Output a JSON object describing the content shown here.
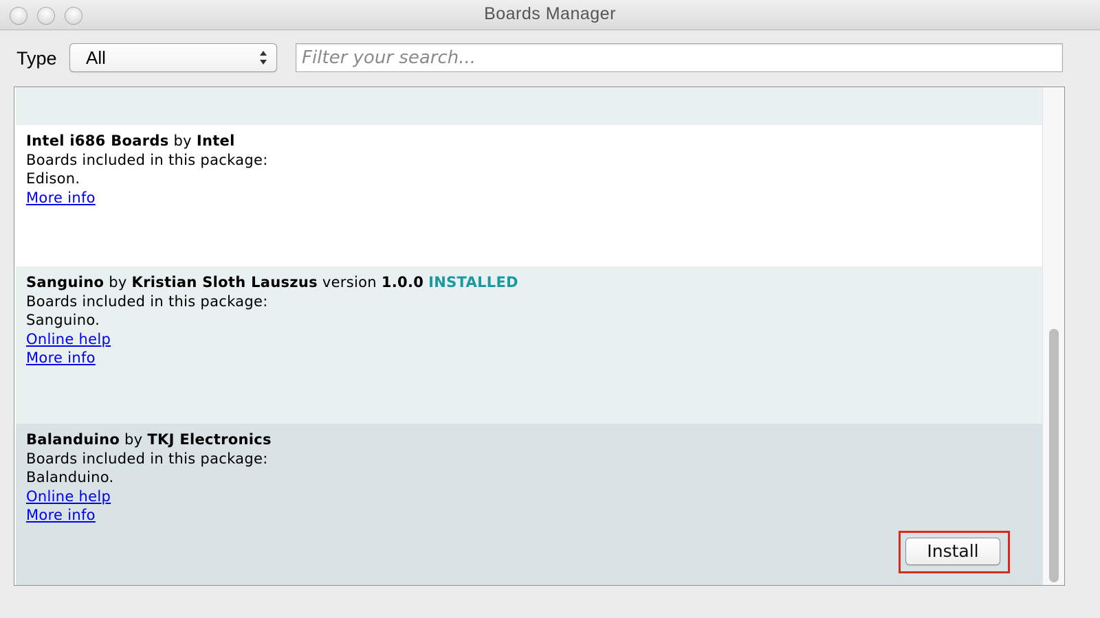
{
  "window": {
    "title": "Boards Manager"
  },
  "filter": {
    "type_label": "Type",
    "type_value": "All",
    "search_placeholder": "Filter your search..."
  },
  "packages": [
    {
      "name": "Intel i686 Boards",
      "by": "by",
      "author": "Intel",
      "boards_label": "Boards included in this package:",
      "boards": "Edison.",
      "more_info": "More info"
    },
    {
      "name": "Sanguino",
      "by": "by",
      "author": "Kristian Sloth Lauszus",
      "version_label": "version",
      "version": "1.0.0",
      "status": "INSTALLED",
      "boards_label": "Boards included in this package:",
      "boards": "Sanguino.",
      "online_help": "Online help",
      "more_info": "More info"
    },
    {
      "name": "Balanduino",
      "by": "by",
      "author": "TKJ Electronics",
      "boards_label": "Boards included in this package:",
      "boards": "Balanduino.",
      "online_help": "Online help",
      "more_info": "More info",
      "install_label": "Install"
    }
  ],
  "colors": {
    "installed": "#1a9aa0",
    "highlight": "#d62b1e",
    "link": "#0000ee"
  }
}
